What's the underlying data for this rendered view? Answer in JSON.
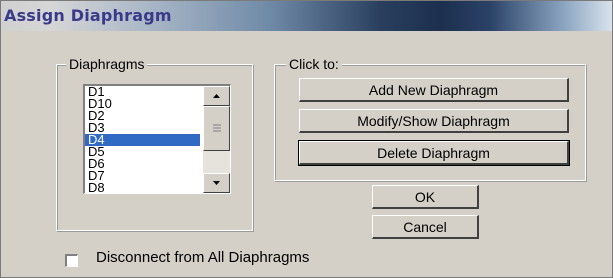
{
  "window": {
    "title": "Assign Diaphragm"
  },
  "diaphragms": {
    "legend": "Diaphragms",
    "items": [
      "D1",
      "D10",
      "D2",
      "D3",
      "D4",
      "D5",
      "D6",
      "D7",
      "D8"
    ],
    "selected": "D4"
  },
  "actions": {
    "legend": "Click to:",
    "add_label": "Add New Diaphragm",
    "modify_label": "Modify/Show Diaphragm",
    "delete_label": "Delete Diaphragm"
  },
  "buttons": {
    "ok_label": "OK",
    "cancel_label": "Cancel"
  },
  "disconnect": {
    "label": "Disconnect from All Diaphragms",
    "checked": false
  }
}
